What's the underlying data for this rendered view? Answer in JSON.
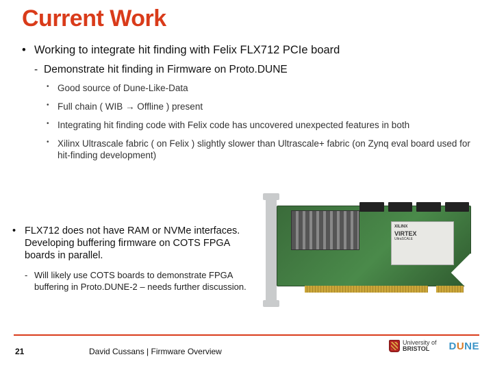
{
  "title": "Current Work",
  "b1": {
    "item": "Working to integrate hit finding with Felix FLX712 PCIe board",
    "sub": "Demonstrate hit finding in Firmware on Proto.DUNE",
    "pts": [
      "Good source of Dune-Like-Data",
      "Full chain ( WIB → Offline ) present",
      "Integrating hit finding code with Felix code has uncovered unexpected features in both",
      "Xilinx Ultrascale fabric ( on Felix ) slightly slower than Ultrascale+ fabric (on Zynq eval board used for hit-finding development)"
    ]
  },
  "b2": {
    "item": "FLX712 does not have RAM or NVMe interfaces. Developing buffering firmware on COTS FPGA boards in parallel.",
    "sub": "Will likely use COTS boards to demonstrate FPGA buffering in Proto.DUNE-2 – needs further discussion."
  },
  "chip": {
    "l1": "XILINX",
    "l2": "VIRTEX",
    "l3": "UltraSCALE"
  },
  "footer": {
    "page": "21",
    "text": "David Cussans | Firmware Overview",
    "bristol1": "University of",
    "bristol2": "BRISTOL",
    "dune_d": "D",
    "dune_u": "U",
    "dune_ne": "NE"
  }
}
